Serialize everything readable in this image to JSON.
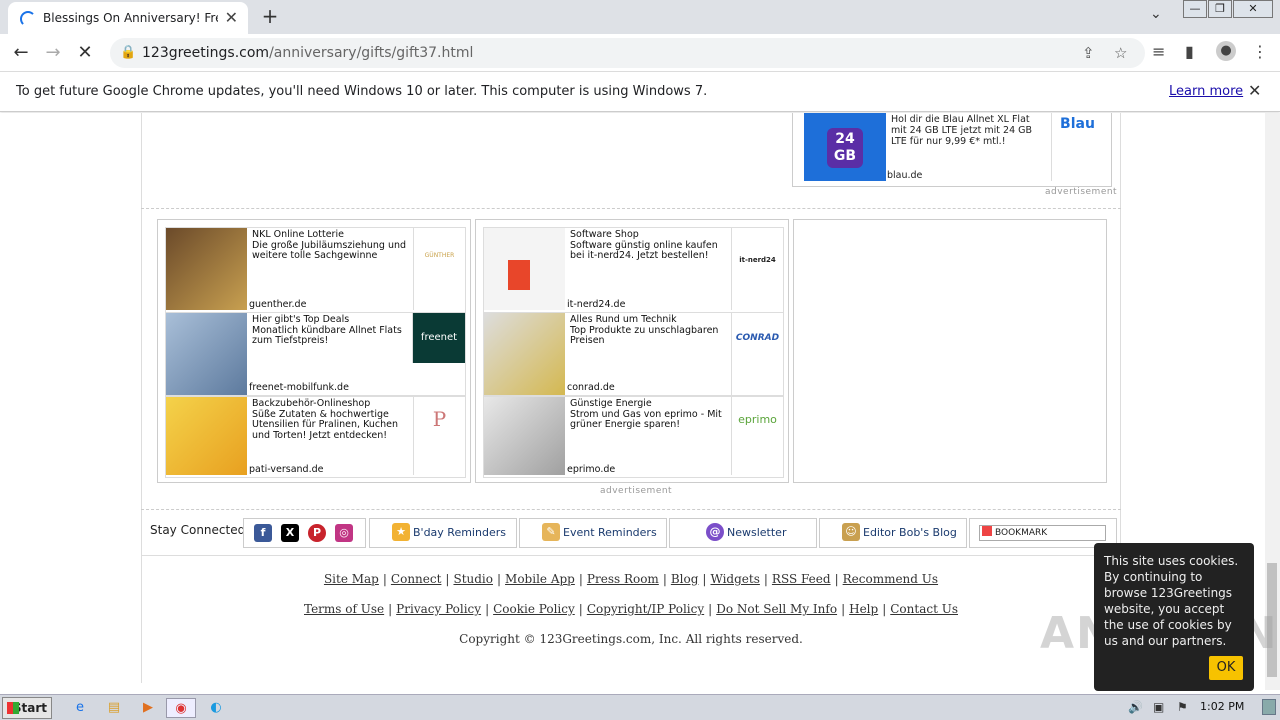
{
  "browser": {
    "tab_title": "Blessings On Anniversary! Free Gifts",
    "url_host": "123greetings.com",
    "url_path": "/anniversary/gifts/gift37.html",
    "infobar_message": "To get future Google Chrome updates, you'll need Windows 10 or later. This computer is using Windows 7.",
    "infobar_link": "Learn more"
  },
  "top_ad": {
    "text": "Hol dir die Blau Allnet XL Flat mit 24 GB LTE jetzt mit 24 GB LTE für nur 9,99 €* mtl.!",
    "domain": "blau.de",
    "logo": "Blau",
    "badge": "24 GB",
    "label": "advertisement"
  },
  "ads_left": [
    {
      "title": "NKL Online Lotterie",
      "desc": "Die große Jubiläumsziehung und weitere tolle Sachgewinne",
      "domain": "guenther.de",
      "logo": "GÜNTHER"
    },
    {
      "title": "Hier gibt's Top Deals",
      "desc": "Monatlich kündbare Allnet Flats zum Tiefstpreis!",
      "domain": "freenet-mobilfunk.de",
      "logo": "freenet"
    },
    {
      "title": "Backzubehör-Onlineshop",
      "desc": "Süße Zutaten & hochwertige Utensilien für Pralinen, Kuchen und Torten! Jetzt entdecken!",
      "domain": "pati-versand.de",
      "logo": "P"
    }
  ],
  "ads_right": [
    {
      "title": "Software Shop",
      "desc": "Software günstig online kaufen bei it-nerd24. Jetzt bestellen!",
      "domain": "it-nerd24.de",
      "logo": "it-nerd24"
    },
    {
      "title": "Alles Rund um Technik",
      "desc": "Top Produkte zu unschlagbaren Preisen",
      "domain": "conrad.de",
      "logo": "CONRAD"
    },
    {
      "title": "Günstige Energie",
      "desc": "Strom und Gas von eprimo - Mit grüner Energie sparen!",
      "domain": "eprimo.de",
      "logo": "eprimo"
    }
  ],
  "ad_label": "advertisement",
  "stay_connected": {
    "label": "Stay Connected",
    "bday": "B'day Reminders",
    "event": "Event Reminders",
    "newsletter": "Newsletter",
    "blog": "Editor Bob's Blog",
    "bookmark": "BOOKMARK"
  },
  "footer_row1": [
    "Site Map",
    "Connect",
    "Studio",
    "Mobile App",
    "Press Room",
    "Blog",
    "Widgets",
    "RSS Feed",
    "Recommend Us"
  ],
  "footer_row2": [
    "Terms of Use",
    "Privacy Policy",
    "Cookie Policy",
    "Copyright/IP Policy",
    "Do Not Sell My Info",
    "Help",
    "Contact Us"
  ],
  "copyright": "Copyright © 123Greetings.com, Inc.   All rights reserved.",
  "cookie": {
    "text": "This site uses cookies. By continuing to browse 123Greetings website, you accept the use of cookies by us and our partners.",
    "ok": "OK"
  },
  "watermark": "ANY RUN",
  "taskbar": {
    "start": "Start",
    "time": "1:02 PM"
  }
}
